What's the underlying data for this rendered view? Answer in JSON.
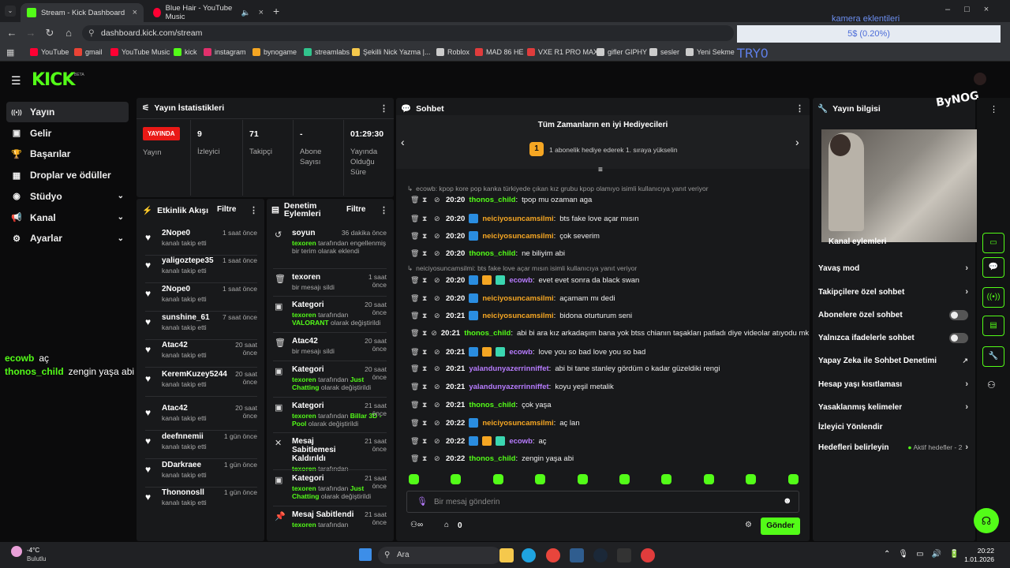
{
  "browser": {
    "tabs": [
      {
        "label": "Stream - Kick Dashboard",
        "icon": "kick-icon"
      },
      {
        "label": "Blue Hair - YouTube Music",
        "icon": "youtube-music-icon"
      }
    ],
    "url": "dashboard.kick.com/stream",
    "bookmarks": [
      "YouTube",
      "gmail",
      "YouTube Music",
      "kick",
      "instagram",
      "bynogame",
      "streamlabs",
      "Şekilli Nick Yazma |...",
      "Roblox",
      "MAD 86 HE",
      "VXE R1 PRO MAX",
      "gifler GIPHY",
      "sesler",
      "Yeni Sekme"
    ]
  },
  "overlay": {
    "title": "kamera eklentileri",
    "progress_text": "5$ (0.20%)",
    "progress_value": 0.002,
    "tryo": "TRY0"
  },
  "app": {
    "logo": "KICK",
    "beta": "BETA",
    "sidebar": [
      {
        "label": "Yayın",
        "icon": "broadcast-icon",
        "active": true
      },
      {
        "label": "Gelir",
        "icon": "revenue-icon"
      },
      {
        "label": "Başarılar",
        "icon": "trophy-icon"
      },
      {
        "label": "Droplar ve ödüller",
        "icon": "gift-icon"
      },
      {
        "label": "Stüdyo",
        "icon": "studio-icon",
        "chevron": true
      },
      {
        "label": "Kanal",
        "icon": "megaphone-icon",
        "chevron": true
      },
      {
        "label": "Ayarlar",
        "icon": "gear-icon",
        "chevron": true
      }
    ]
  },
  "stats": {
    "title": "Yayın İstatistikleri",
    "live": "YAYINDA",
    "live_label": "Yayın",
    "cells": [
      {
        "value": "9",
        "label": "İzleyici"
      },
      {
        "value": "71",
        "label": "Takipçi"
      },
      {
        "value": "-",
        "label": "Abone Sayısı"
      },
      {
        "value": "01:29:30",
        "label": "Yayında Olduğu Süre"
      }
    ]
  },
  "activity": {
    "title": "Etkinlik Akışı",
    "filter": "Filtre",
    "items": [
      {
        "name": "2Nope0",
        "sub": "kanalı takip etti",
        "time": "1 saat önce"
      },
      {
        "name": "yaligoztepe35",
        "sub": "kanalı takip etti",
        "time": "1 saat önce"
      },
      {
        "name": "2Nope0",
        "sub": "kanalı takip etti",
        "time": "1 saat önce"
      },
      {
        "name": "sunshine_61",
        "sub": "kanalı takip etti",
        "time": "7 saat önce"
      },
      {
        "name": "Atac42",
        "sub": "kanalı takip etti",
        "time": "20 saat önce"
      },
      {
        "name": "KeremKuzey5244",
        "sub": "kanalı takip etti",
        "time": "20 saat önce"
      },
      {
        "name": "Atac42",
        "sub": "kanalı takip etti",
        "time": "20 saat önce"
      },
      {
        "name": "deefnnemii",
        "sub": "kanalı takip etti",
        "time": "1 gün önce"
      },
      {
        "name": "DDarkraee",
        "sub": "kanalı takip etti",
        "time": "1 gün önce"
      },
      {
        "name": "Thononosll",
        "sub": "kanalı takip etti",
        "time": "1 gün önce"
      }
    ]
  },
  "moderation": {
    "title": "Denetim Eylemleri",
    "filter": "Filtre",
    "items": [
      {
        "name": "soyun",
        "user": "texoren",
        "sub": "tarafından engellenmiş bir terim olarak eklendi",
        "time": "36 dakika önce",
        "icon": "undo-icon"
      },
      {
        "name": "texoren",
        "user": "",
        "sub": "bir mesajı sildi",
        "time": "1 saat önce",
        "icon": "trash-icon"
      },
      {
        "name": "Kategori",
        "user": "texoren",
        "sub": "tarafından",
        "extra": "VALORANT",
        "sub2": "olarak değiştirildi",
        "time": "20 saat önce",
        "icon": "category-icon"
      },
      {
        "name": "Atac42",
        "user": "",
        "sub": "bir mesajı sildi",
        "time": "20 saat önce",
        "icon": "trash-icon"
      },
      {
        "name": "Kategori",
        "user": "texoren",
        "sub": "tarafından",
        "extra": "Just Chatting",
        "sub2": "olarak değiştirildi",
        "time": "20 saat önce",
        "icon": "category-icon"
      },
      {
        "name": "Kategori",
        "user": "texoren",
        "sub": "tarafından",
        "extra": "Billar 3D - Pool",
        "sub2": "olarak değiştirildi",
        "time": "21 saat önce",
        "icon": "category-icon"
      },
      {
        "name": "Mesaj Sabitlemesi Kaldırıldı",
        "user": "texoren",
        "sub": "tarafından",
        "time": "21 saat önce",
        "icon": "unpin-icon"
      },
      {
        "name": "Kategori",
        "user": "texoren",
        "sub": "tarafından",
        "extra": "Just Chatting",
        "sub2": "olarak değiştirildi",
        "time": "21 saat önce",
        "icon": "category-icon"
      },
      {
        "name": "Mesaj Sabitlendi",
        "user": "texoren",
        "sub": "tarafından",
        "time": "21 saat önce",
        "icon": "pin-icon"
      }
    ]
  },
  "chat": {
    "title": "Sohbet",
    "gifter_title": "Tüm Zamanların en iyi Hediyecileri",
    "gifter_rank": "1",
    "gifter_text": "1 abonelik hediye ederek 1. sıraya yükselin",
    "placeholder": "Bir mesaj gönderin",
    "send": "Gönder",
    "points": "0",
    "lines": [
      {
        "reply": "ecowb: kpop kore pop kanka türkiyede çıkan kız grubu kpop olamıyo isimli kullanıcıya yanıt veriyor"
      },
      {
        "ts": "20:20",
        "user": "thonos_child",
        "color": "#53fc18",
        "msg": "tpop mu ozaman aga",
        "badges": []
      },
      {
        "ts": "20:20",
        "user": "neiciyosuncamsilmi",
        "color": "#f5a623",
        "msg": "bts fake love açar mısın",
        "badges": [
          "#2a8de0"
        ]
      },
      {
        "ts": "20:20",
        "user": "neiciyosuncamsilmi",
        "color": "#f5a623",
        "msg": "çok severim",
        "badges": [
          "#2a8de0"
        ]
      },
      {
        "ts": "20:20",
        "user": "thonos_child",
        "color": "#53fc18",
        "msg": "ne biliyim abi",
        "badges": []
      },
      {
        "reply": "neiciyosuncamsilmi: bts fake love açar mısın isimli kullanıcıya yanıt veriyor"
      },
      {
        "ts": "20:20",
        "user": "ecowb",
        "color": "#b77cff",
        "msg": "evet evet sonra da black swan",
        "badges": [
          "#2a8de0",
          "#f5a623",
          "#3ad6b0"
        ]
      },
      {
        "ts": "20:20",
        "user": "neiciyosuncamsilmi",
        "color": "#f5a623",
        "msg": "açamam mı dedi",
        "badges": [
          "#2a8de0"
        ]
      },
      {
        "ts": "20:21",
        "user": "neiciyosuncamsilmi",
        "color": "#f5a623",
        "msg": "bidona oturturum seni",
        "badges": [
          "#2a8de0"
        ]
      },
      {
        "ts": "20:21",
        "user": "thonos_child",
        "color": "#53fc18",
        "msg": "abi bi ara kız arkadaşım bana yok btss chianın taşakları patladı diye videolar atıyodu mk",
        "badges": []
      },
      {
        "ts": "20:21",
        "user": "ecowb",
        "color": "#b77cff",
        "msg": "love you so bad love you so bad",
        "badges": [
          "#2a8de0",
          "#f5a623",
          "#3ad6b0"
        ]
      },
      {
        "ts": "20:21",
        "user": "yalandunyazerrinniffet",
        "color": "#b77cff",
        "msg": "abi bi tane stanley gördüm o kadar güzeldiki rengi",
        "badges": []
      },
      {
        "ts": "20:21",
        "user": "yalandunyazerrinniffet",
        "color": "#b77cff",
        "msg": "koyu yeşil metalik",
        "badges": []
      },
      {
        "ts": "20:21",
        "user": "thonos_child",
        "color": "#53fc18",
        "msg": "çok yaşa",
        "badges": []
      },
      {
        "ts": "20:22",
        "user": "neiciyosuncamsilmi",
        "color": "#f5a623",
        "msg": "aç lan",
        "badges": [
          "#2a8de0"
        ]
      },
      {
        "ts": "20:22",
        "user": "ecowb",
        "color": "#b77cff",
        "msg": "aç",
        "badges": [
          "#2a8de0",
          "#f5a623",
          "#3ad6b0"
        ]
      },
      {
        "ts": "20:22",
        "user": "thonos_child",
        "color": "#53fc18",
        "msg": "zengin yaşa abi",
        "badges": []
      }
    ]
  },
  "streaminfo": {
    "title": "Yayın bilgisi",
    "actions_label": "Kanal eylemleri",
    "items": [
      {
        "label": "Yavaş mod",
        "type": "chevron"
      },
      {
        "label": "Takipçilere özel sohbet",
        "type": "chevron"
      },
      {
        "label": "Abonelere özel sohbet",
        "type": "toggle"
      },
      {
        "label": "Yalnızca ifadelerle sohbet",
        "type": "toggle"
      },
      {
        "label": "Yapay Zeka ile Sohbet Denetimi",
        "type": "external"
      },
      {
        "label": "Hesap yaşı kısıtlaması",
        "type": "chevron"
      },
      {
        "label": "Yasaklanmış kelimeler",
        "type": "chevron"
      },
      {
        "label": "İzleyici Yönlendir",
        "type": "none"
      },
      {
        "label": "Hedefleri belirleyin",
        "type": "goal"
      }
    ],
    "goal_text": "Aktif hedefler - 2",
    "brand": "ByNOG"
  },
  "stream_overlay_chat": [
    {
      "user": "ecowb",
      "msg": "aç",
      "color": "#53fc18"
    },
    {
      "user": "thonos_child",
      "msg": "zengin yaşa abi",
      "color": "#53fc18"
    }
  ],
  "taskbar": {
    "weather_temp": "-4°C",
    "weather_text": "Bulutlu",
    "search": "Ara",
    "time": "20:22",
    "date": "1.01.2026"
  }
}
